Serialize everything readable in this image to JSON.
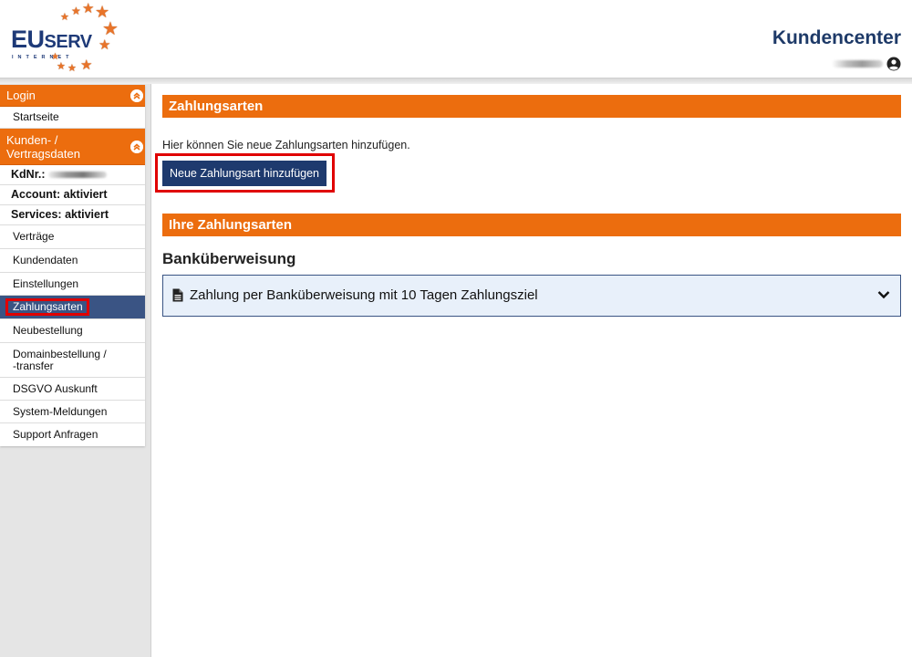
{
  "header": {
    "logo_main": "EU",
    "logo_serv": "SERV",
    "logo_sub": "INTERNET",
    "title": "Kundencenter"
  },
  "sidebar": {
    "login_label": "Login",
    "startseite": "Startseite",
    "kunden_line1": "Kunden- /",
    "kunden_line2": "Vertragsdaten",
    "kdnr_label": "KdNr.:",
    "account_status": "Account: aktiviert",
    "services_status": "Services: aktiviert",
    "items": [
      "Verträge",
      "Kundendaten",
      "Einstellungen",
      "Zahlungsarten",
      "Neubestellung",
      "Domainbestellung /",
      "-transfer",
      "DSGVO Auskunft",
      "System-Meldungen",
      "Support Anfragen"
    ]
  },
  "main": {
    "section_title": "Zahlungsarten",
    "intro_text": "Hier können Sie neue Zahlungsarten hinzufügen.",
    "add_button": "Neue Zahlungsart hinzufügen",
    "your_methods_title": "Ihre Zahlungsarten",
    "method_group_title": "Banküberweisung",
    "method_label": "Zahlung per Banküberweisung mit 10 Tagen Zahlungsziel"
  },
  "colors": {
    "orange": "#ec6d0e",
    "navy": "#1e3a6e",
    "active_item": "#3a5484",
    "highlight_red": "#e00000"
  },
  "icons": {
    "user": "user-circle-icon",
    "collapse": "chevron-double-up-icon",
    "document": "document-icon",
    "expand": "chevron-down-icon"
  }
}
